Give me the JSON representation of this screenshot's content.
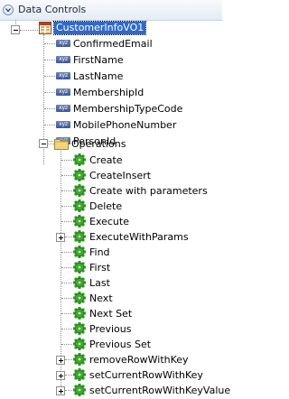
{
  "header": {
    "title": "Data Controls",
    "toggle_icon": "collapse-circle-icon"
  },
  "root": {
    "label": "CustomerInfoVO1",
    "icon": "view-object-icon"
  },
  "attributes": [
    {
      "label": "ConfirmedEmail",
      "icon": "attribute-xyz-icon"
    },
    {
      "label": "FirstName",
      "icon": "attribute-xyz-icon"
    },
    {
      "label": "LastName",
      "icon": "attribute-xyz-icon"
    },
    {
      "label": "MembershipId",
      "icon": "attribute-xyz-icon"
    },
    {
      "label": "MembershipTypeCode",
      "icon": "attribute-xyz-icon"
    },
    {
      "label": "MobilePhoneNumber",
      "icon": "attribute-xyz-icon"
    },
    {
      "label": "PersonId",
      "icon": "attribute-xyz-icon"
    }
  ],
  "operations_folder": {
    "label": "Operations",
    "icon": "folder-icon"
  },
  "operations": [
    {
      "label": "Create",
      "expandable": false
    },
    {
      "label": "CreateInsert",
      "expandable": false
    },
    {
      "label": "Create with parameters",
      "expandable": false
    },
    {
      "label": "Delete",
      "expandable": false
    },
    {
      "label": "Execute",
      "expandable": false
    },
    {
      "label": "ExecuteWithParams",
      "expandable": true
    },
    {
      "label": "Find",
      "expandable": false
    },
    {
      "label": "First",
      "expandable": false
    },
    {
      "label": "Last",
      "expandable": false
    },
    {
      "label": "Next",
      "expandable": false
    },
    {
      "label": "Next Set",
      "expandable": false
    },
    {
      "label": "Previous",
      "expandable": false
    },
    {
      "label": "Previous Set",
      "expandable": false
    },
    {
      "label": "removeRowWithKey",
      "expandable": true
    },
    {
      "label": "setCurrentRowWithKey",
      "expandable": true
    },
    {
      "label": "setCurrentRowWithKeyValue",
      "expandable": true
    }
  ],
  "colors": {
    "selection": "#3169c6",
    "gear": "#2f9a22",
    "folder": "#e7c15a",
    "xyz_badge": "#4a66a3"
  }
}
